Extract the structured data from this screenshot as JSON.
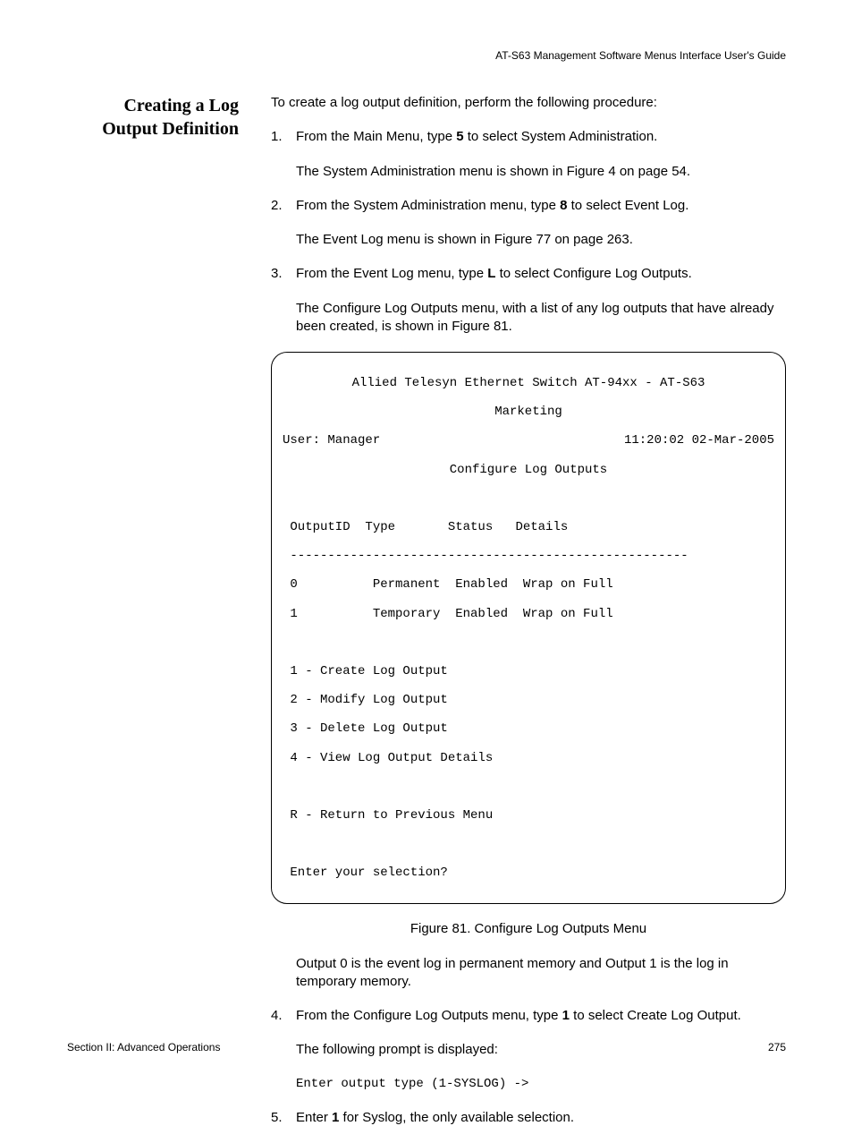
{
  "header": "AT-S63 Management Software Menus Interface User's Guide",
  "section_title_l1": "Creating a Log",
  "section_title_l2": "Output Definition",
  "intro": "To create a log output definition, perform the following procedure:",
  "step1": {
    "num": "1.",
    "text_a": "From the Main Menu, type ",
    "bold": "5",
    "text_b": " to select System Administration.",
    "follow": "The System Administration menu is shown in Figure 4 on page 54."
  },
  "step2": {
    "num": "2.",
    "text_a": "From the System Administration menu, type ",
    "bold": "8",
    "text_b": " to select Event Log.",
    "follow": "The Event Log menu is shown in Figure 77 on page 263."
  },
  "step3": {
    "num": "3.",
    "text_a": "From the Event Log menu, type ",
    "bold": "L",
    "text_b": " to select Configure Log Outputs.",
    "follow": "The Configure Log Outputs menu, with a list of any log outputs that have already been created, is shown in Figure 81."
  },
  "terminal": {
    "line1": "Allied Telesyn Ethernet Switch AT-94xx - AT-S63",
    "line2": "Marketing",
    "user": "User: Manager",
    "timestamp": "11:20:02 02-Mar-2005",
    "title": "Configure Log Outputs",
    "table_header": " OutputID  Type       Status   Details",
    "table_divider": " -----------------------------------------------------",
    "row0": " 0          Permanent  Enabled  Wrap on Full",
    "row1": " 1          Temporary  Enabled  Wrap on Full",
    "menu1": " 1 - Create Log Output",
    "menu2": " 2 - Modify Log Output",
    "menu3": " 3 - Delete Log Output",
    "menu4": " 4 - View Log Output Details",
    "menuR": " R - Return to Previous Menu",
    "prompt": " Enter your selection?"
  },
  "figure_caption": "Figure 81. Configure Log Outputs Menu",
  "after_figure": "Output 0 is the event log in permanent memory and Output 1 is the log in temporary memory.",
  "step4": {
    "num": "4.",
    "text_a": "From the Configure Log Outputs menu, type ",
    "bold": "1",
    "text_b": " to select Create Log Output.",
    "follow": "The following prompt is displayed:"
  },
  "prompt_line": "Enter output type (1-SYSLOG) ->",
  "step5": {
    "num": "5.",
    "text_a": "Enter ",
    "bold": "1",
    "text_b": " for Syslog, the only available selection."
  },
  "footer_left": "Section II: Advanced Operations",
  "footer_right": "275"
}
